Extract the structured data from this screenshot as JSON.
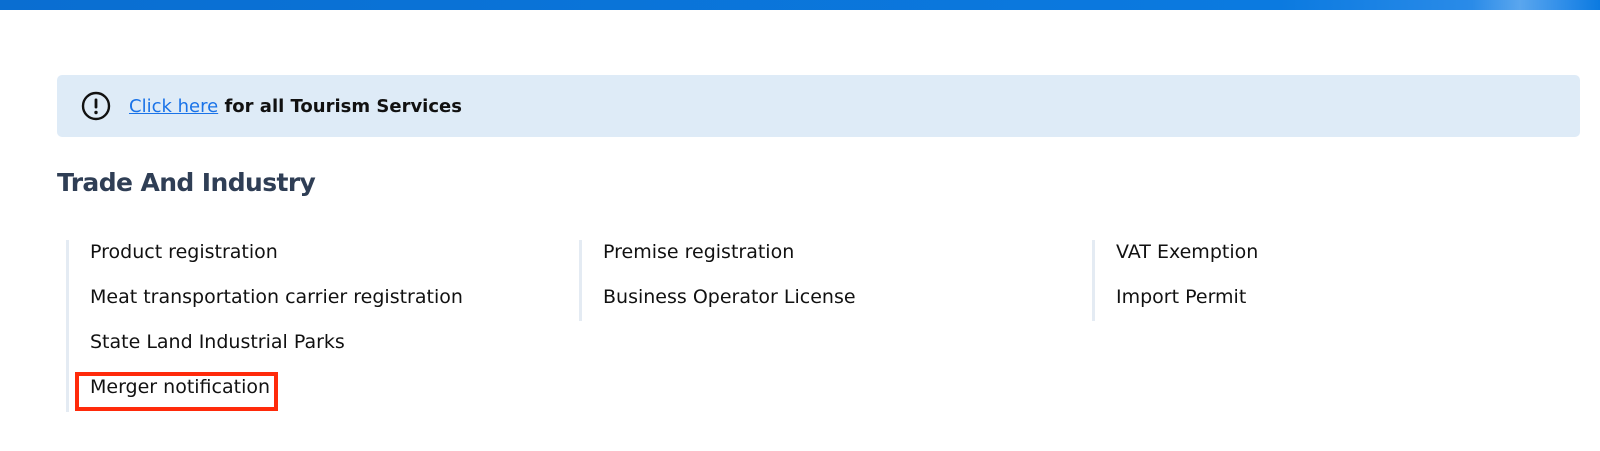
{
  "notice": {
    "link_text": " Click here",
    "message": " for all Tourism Services",
    "icon": "exclamation-circle-icon"
  },
  "section": {
    "title": "Trade And Industry"
  },
  "columns": [
    {
      "items": [
        "Product registration",
        "Meat transportation carrier registration",
        "State Land Industrial Parks",
        "Merger notification"
      ]
    },
    {
      "items": [
        "Premise registration",
        "Business Operator License"
      ]
    },
    {
      "items": [
        "VAT Exemption",
        "Import Permit"
      ]
    }
  ],
  "colors": {
    "top_bar": "#0a6ed1",
    "notice_bg": "#deebf7",
    "link": "#1a73e8",
    "title": "#2f3e55",
    "highlight": "#ff2a0a"
  }
}
